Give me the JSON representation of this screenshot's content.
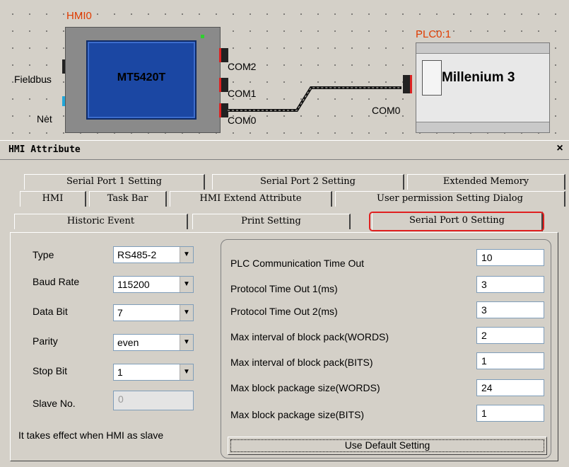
{
  "diagram": {
    "hmi_label": "HMI0",
    "hmi_model": "MT5420T",
    "fieldbus_label": "Fieldbus",
    "net_label": "Net",
    "com2_label": "COM2",
    "com1_label": "COM1",
    "com0_label": "COM0",
    "plc_label": "PLC0:1",
    "plc_com_label": "COM0",
    "plc_name": "Millenium 3"
  },
  "dialog": {
    "title": "HMI Attribute",
    "close_glyph": "×",
    "tabs": {
      "row1": [
        "Serial Port 1 Setting",
        "Serial Port 2 Setting",
        "Extended Memory"
      ],
      "row2": [
        "HMI",
        "Task Bar",
        "HMI Extend Attribute",
        "User permission Setting Dialog"
      ],
      "row3": [
        "Historic Event",
        "Print Setting",
        "Serial Port 0 Setting"
      ]
    },
    "active_tab": "Serial Port 0 Setting",
    "left": {
      "type": {
        "label": "Type",
        "value": "RS485-2"
      },
      "baud": {
        "label": "Baud Rate",
        "value": "115200"
      },
      "databit": {
        "label": "Data Bit",
        "value": "7"
      },
      "parity": {
        "label": "Parity",
        "value": "even"
      },
      "stopbit": {
        "label": "Stop Bit",
        "value": "1"
      },
      "slave": {
        "label": "Slave No.",
        "value": "0"
      },
      "note": "It takes effect when HMI as slave"
    },
    "right": {
      "rows": [
        {
          "label": "PLC Communication Time Out",
          "value": "10"
        },
        {
          "label": "Protocol Time Out 1(ms)",
          "value": "3"
        },
        {
          "label": "Protocol Time Out 2(ms)",
          "value": "3"
        },
        {
          "label": "Max interval of block pack(WORDS)",
          "value": "2"
        },
        {
          "label": "Max interval of block pack(BITS)",
          "value": "1"
        },
        {
          "label": "Max block package size(WORDS)",
          "value": "24"
        },
        {
          "label": "Max block package size(BITS)",
          "value": "1"
        }
      ],
      "default_button": "Use Default Setting"
    }
  },
  "colors": {
    "highlight": "#e02020",
    "screen": "#1b47a3",
    "dialog_bg": "#d4d0c8"
  }
}
